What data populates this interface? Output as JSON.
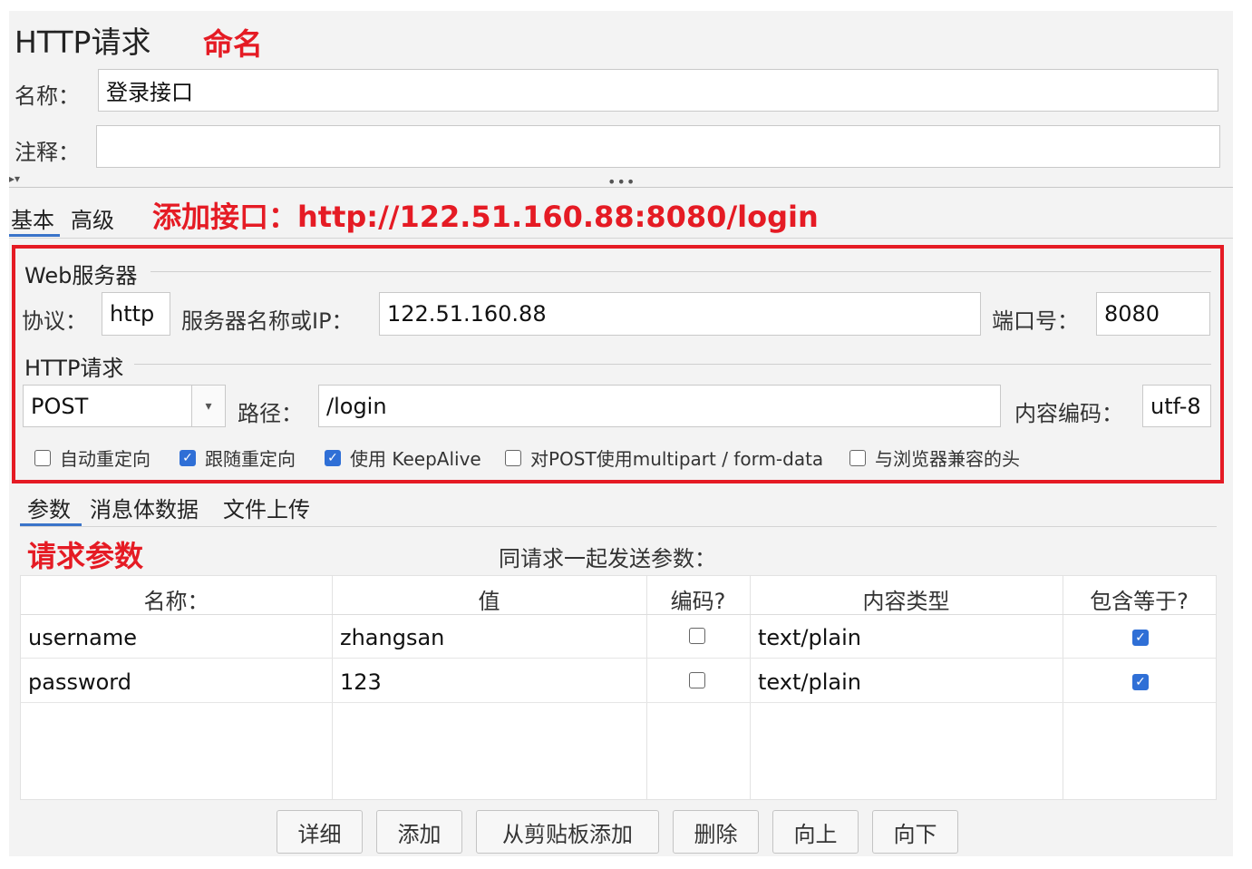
{
  "header": {
    "title": "HTTP请求",
    "annotation_name": "命名",
    "name_label": "名称：",
    "name_value": "登录接口",
    "comment_label": "注释：",
    "comment_value": ""
  },
  "splitter": {
    "dots": "•••",
    "arrows": "▸▾"
  },
  "tabs": [
    {
      "label": "基本",
      "active": true
    },
    {
      "label": "高级",
      "active": false
    }
  ],
  "annotation_url": "添加接口：http://122.51.160.88:8080/login",
  "web_server": {
    "group_title": "Web服务器",
    "protocol_label": "协议：",
    "protocol_value": "http",
    "server_label": "服务器名称或IP：",
    "server_value": "122.51.160.88",
    "port_label": "端口号：",
    "port_value": "8080"
  },
  "http_request": {
    "group_title": "HTTP请求",
    "method_value": "POST",
    "path_label": "路径：",
    "path_value": "/login",
    "encoding_label": "内容编码：",
    "encoding_value": "utf-8"
  },
  "options": [
    {
      "label": "自动重定向",
      "checked": false
    },
    {
      "label": "跟随重定向",
      "checked": true
    },
    {
      "label": "使用 KeepAlive",
      "checked": true
    },
    {
      "label": "对POST使用multipart / form-data",
      "checked": false
    },
    {
      "label": "与浏览器兼容的头",
      "checked": false
    }
  ],
  "sub_tabs": [
    {
      "label": "参数",
      "active": true
    },
    {
      "label": "消息体数据",
      "active": false
    },
    {
      "label": "文件上传",
      "active": false
    }
  ],
  "annotation_params": "请求参数",
  "params_caption": "同请求一起发送参数：",
  "table": {
    "headers": [
      "名称：",
      "值",
      "编码?",
      "内容类型",
      "包含等于?"
    ],
    "rows": [
      {
        "name": "username",
        "value": "zhangsan",
        "encode": false,
        "content_type": "text/plain",
        "include_equals": true
      },
      {
        "name": "password",
        "value": "123",
        "encode": false,
        "content_type": "text/plain",
        "include_equals": true
      }
    ]
  },
  "buttons": [
    "详细",
    "添加",
    "从剪贴板添加",
    "删除",
    "向上",
    "向下"
  ],
  "colors": {
    "annotation_red": "#e51b24",
    "accent_blue": "#2f6fd6"
  },
  "icons": {
    "check": "✓",
    "dropdown": "▾"
  }
}
